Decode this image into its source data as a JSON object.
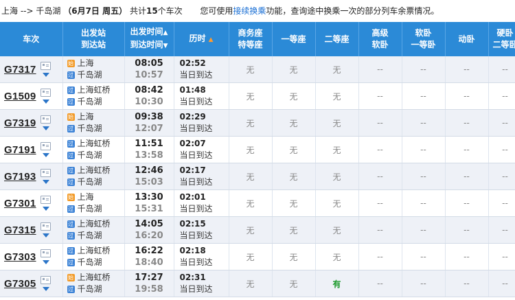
{
  "summary": {
    "from": "上海",
    "arrow": "-->",
    "to": "千岛湖",
    "date_text": "（6月7日  周五）",
    "count_prefix": "共计",
    "count": "15",
    "count_suffix": "个车次",
    "hint_prefix": "您可使用",
    "hint_link": "接续换乘",
    "hint_suffix": "功能，查询途中换乘一次的部分列车余票情况。"
  },
  "headers": {
    "train": "车次",
    "station_top": "出发站",
    "station_bottom": "到达站",
    "time_top": "出发时间",
    "time_top_sort": "▲",
    "time_bottom": "到达时间",
    "time_bottom_sort": "▼",
    "duration": "历时",
    "duration_sort": "▲",
    "business_top": "商务座",
    "business_bottom": "特等座",
    "first": "一等座",
    "second": "二等座",
    "premium_top": "高级",
    "premium_bottom": "软卧",
    "soft_top": "软卧",
    "soft_bottom": "一等卧",
    "dongwo": "动卧",
    "hard_top": "硬卧",
    "hard_bottom": "二等卧"
  },
  "badges": {
    "origin": "始",
    "pass": "过"
  },
  "trains": [
    {
      "no": "G7317",
      "from": "上海",
      "from_type": "origin",
      "to": "千岛湖",
      "dep": "08:05",
      "arr": "10:57",
      "dur": "02:52",
      "same_day": "当日到达",
      "business": "无",
      "first": "无",
      "second": "无",
      "premium": "--",
      "soft": "--",
      "dongwo": "--",
      "hard": "--"
    },
    {
      "no": "G1509",
      "from": "上海虹桥",
      "from_type": "pass",
      "to": "千岛湖",
      "dep": "08:42",
      "arr": "10:30",
      "dur": "01:48",
      "same_day": "当日到达",
      "business": "无",
      "first": "无",
      "second": "无",
      "premium": "--",
      "soft": "--",
      "dongwo": "--",
      "hard": "--"
    },
    {
      "no": "G7319",
      "from": "上海",
      "from_type": "origin",
      "to": "千岛湖",
      "dep": "09:38",
      "arr": "12:07",
      "dur": "02:29",
      "same_day": "当日到达",
      "business": "无",
      "first": "无",
      "second": "无",
      "premium": "--",
      "soft": "--",
      "dongwo": "--",
      "hard": "--"
    },
    {
      "no": "G7191",
      "from": "上海虹桥",
      "from_type": "pass",
      "to": "千岛湖",
      "dep": "11:51",
      "arr": "13:58",
      "dur": "02:07",
      "same_day": "当日到达",
      "business": "无",
      "first": "无",
      "second": "无",
      "premium": "--",
      "soft": "--",
      "dongwo": "--",
      "hard": "--"
    },
    {
      "no": "G7193",
      "from": "上海虹桥",
      "from_type": "pass",
      "to": "千岛湖",
      "dep": "12:46",
      "arr": "15:03",
      "dur": "02:17",
      "same_day": "当日到达",
      "business": "无",
      "first": "无",
      "second": "无",
      "premium": "--",
      "soft": "--",
      "dongwo": "--",
      "hard": "--"
    },
    {
      "no": "G7301",
      "from": "上海",
      "from_type": "origin",
      "to": "千岛湖",
      "dep": "13:30",
      "arr": "15:31",
      "dur": "02:01",
      "same_day": "当日到达",
      "business": "无",
      "first": "无",
      "second": "无",
      "premium": "--",
      "soft": "--",
      "dongwo": "--",
      "hard": "--"
    },
    {
      "no": "G7315",
      "from": "上海虹桥",
      "from_type": "pass",
      "to": "千岛湖",
      "dep": "14:05",
      "arr": "16:20",
      "dur": "02:15",
      "same_day": "当日到达",
      "business": "无",
      "first": "无",
      "second": "无",
      "premium": "--",
      "soft": "--",
      "dongwo": "--",
      "hard": "--"
    },
    {
      "no": "G7303",
      "from": "上海虹桥",
      "from_type": "pass",
      "to": "千岛湖",
      "dep": "16:22",
      "arr": "18:40",
      "dur": "02:18",
      "same_day": "当日到达",
      "business": "无",
      "first": "无",
      "second": "无",
      "premium": "--",
      "soft": "--",
      "dongwo": "--",
      "hard": "--"
    },
    {
      "no": "G7305",
      "from": "上海虹桥",
      "from_type": "origin",
      "to": "千岛湖",
      "dep": "17:27",
      "arr": "19:58",
      "dur": "02:31",
      "same_day": "当日到达",
      "business": "无",
      "first": "无",
      "second": "有",
      "premium": "--",
      "soft": "--",
      "dongwo": "--",
      "hard": "--"
    }
  ],
  "colors": {
    "header_bg": "#2b8ad7",
    "row_alt_bg": "#eef1f7",
    "link": "#1a6fd4",
    "available": "#1c9a2c",
    "badge_origin": "#f39b28",
    "badge_pass": "#3b82d6",
    "sort_active": "#ff9b2e"
  },
  "icons": {
    "detail": "ticket-card-icon",
    "expand": "expand-triangle-icon"
  }
}
